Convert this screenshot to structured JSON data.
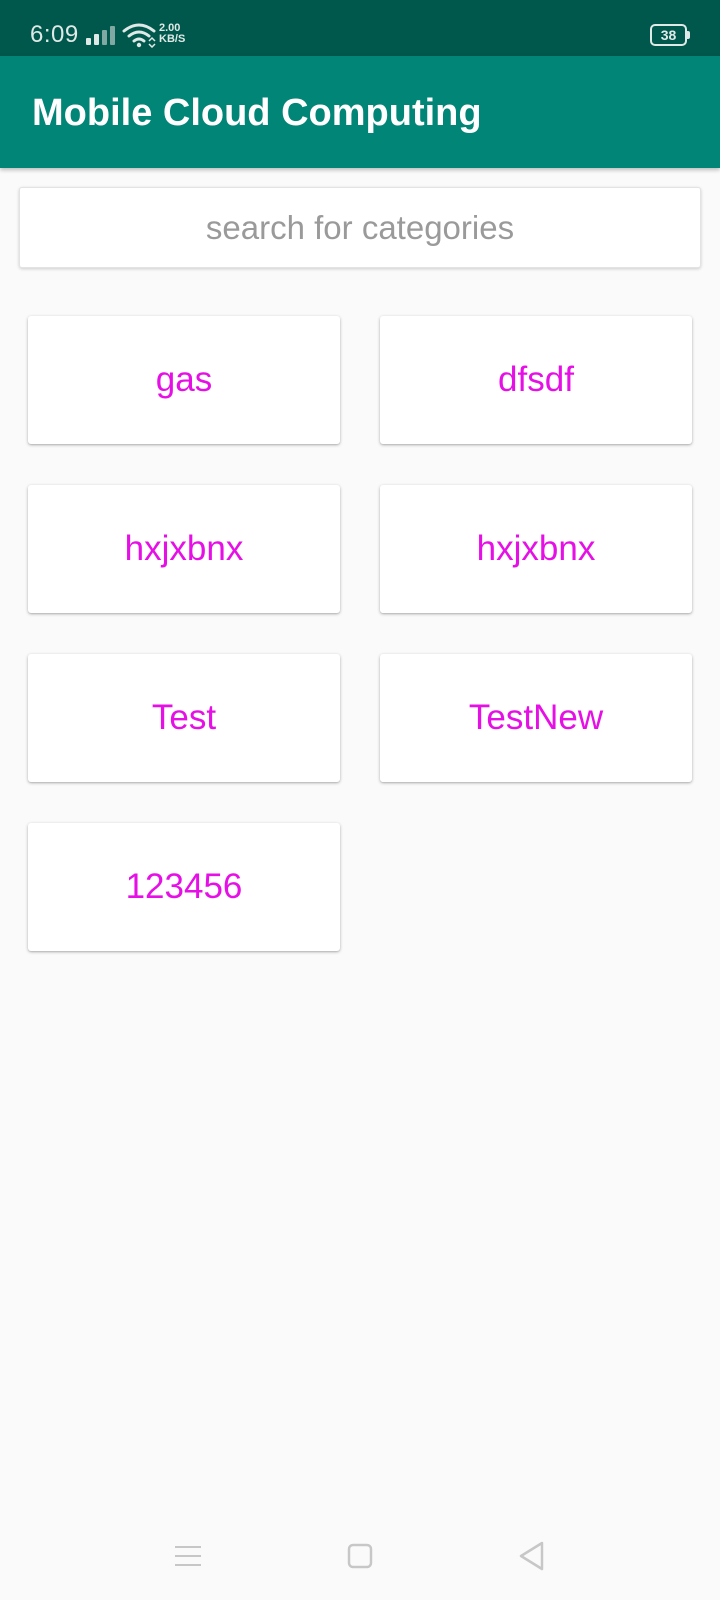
{
  "status_bar": {
    "time": "6:09",
    "net_speed_value": "2.00",
    "net_speed_unit": "KB/S",
    "battery_level": "38",
    "icons": [
      "signal-icon",
      "wifi-icon",
      "battery-icon"
    ]
  },
  "app_bar": {
    "title": "Mobile Cloud Computing",
    "color": "#008577"
  },
  "search": {
    "placeholder": "search for categories",
    "value": ""
  },
  "categories": [
    {
      "label": "gas"
    },
    {
      "label": "dfsdf"
    },
    {
      "label": "hxjxbnx"
    },
    {
      "label": "hxjxbnx"
    },
    {
      "label": "Test"
    },
    {
      "label": "TestNew"
    },
    {
      "label": "123456"
    }
  ],
  "colors": {
    "status_bar": "#00574b",
    "accent_text": "#e60fe6",
    "background": "#fafafa"
  },
  "nav_bar": {
    "icons": [
      "menu-icon",
      "home-icon",
      "back-icon"
    ]
  }
}
